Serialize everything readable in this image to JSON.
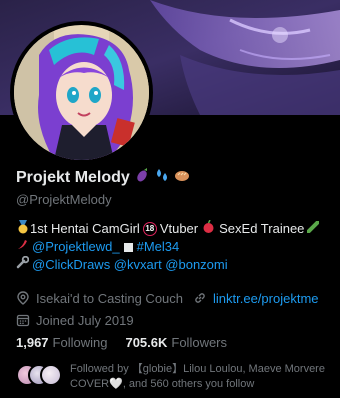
{
  "profile": {
    "display_name": "Projekt Melody",
    "name_emojis": [
      "eggplant",
      "sweat-droplets",
      "bread"
    ],
    "handle": "@ProjektMelody"
  },
  "bio": {
    "line1": {
      "part1": "1st Hentai CamGirl",
      "part2": "Vtuber",
      "part3": "SexEd Trainee"
    },
    "line2": {
      "link1": "@Projektlewd_",
      "link2": "#Mel34"
    },
    "line3": {
      "links": "@ClickDraws @kvxart @bonzomi"
    }
  },
  "meta": {
    "location": "Isekai'd to Casting Couch",
    "website": "linktr.ee/projektme",
    "joined": "Joined July 2019"
  },
  "stats": {
    "following_count": "1,967",
    "following_label": "Following",
    "followers_count": "705.6K",
    "followers_label": "Followers"
  },
  "followed_by": {
    "line1": "Followed by 【globie】Lilou Loulou, Maeve Morvere",
    "line2": "COVER🤍, and 560 others you follow"
  },
  "colors": {
    "accent": "#1d9bf0",
    "muted": "#71767b",
    "text": "#e7e9ea",
    "background": "#000000"
  }
}
